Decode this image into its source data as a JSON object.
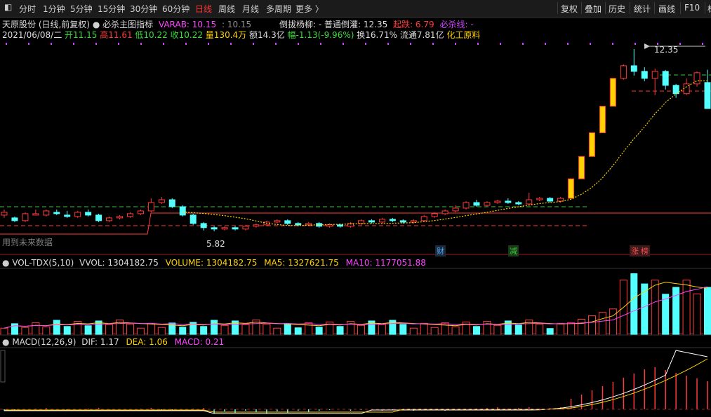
{
  "toolbar": {
    "left_tabs": [
      "分时",
      "1分钟",
      "5分钟",
      "15分钟",
      "30分钟",
      "60分钟",
      "日线",
      "周线",
      "月线",
      "多周期",
      "更多 〉"
    ],
    "active_tab": "日线",
    "right_tabs": [
      "复权",
      "叠加",
      "历史",
      "统计",
      "画线",
      "F10",
      "标"
    ]
  },
  "info1": {
    "stock": "天原股份 (日线,前复权)",
    "indicator": "必杀主图指标",
    "varab": "VARAB: 10.15",
    "varab2": ": 10.15",
    "daoba": "倒拔杨柳: - 普通倒灌: 12.35",
    "qidie": "起跌: 6.79",
    "bisha": "必杀线: -"
  },
  "info2": {
    "date": "2021/06/08/二",
    "open": "开11.15",
    "high": "高11.61",
    "low": "低10.22",
    "close": "收10.22",
    "vol": "量130.4万",
    "amount": "额14.3亿",
    "change": "幅-1.13(-9.96%)",
    "turnover": "换16.71%",
    "float": "流通7.81亿",
    "sector": "化工原料"
  },
  "price_panel": {
    "max_label": "12.35",
    "min_label": "5.82",
    "future_label": "用到未来数据",
    "markers": [
      {
        "text": "财",
        "color": "#4da6ff"
      },
      {
        "text": "减",
        "color": "#3cc83c"
      },
      {
        "text": "涨",
        "color": "#ff4d4d"
      },
      {
        "text": "榜",
        "color": "#ff4d4d"
      }
    ]
  },
  "vol_title": {
    "name": "VOL-TDX(5,10)",
    "vvol": "VVOL: 1304182.75",
    "volume": "VOLUME: 1304182.75",
    "ma5": "MA5: 1327621.75",
    "ma10": "MA10: 1177051.88"
  },
  "macd_title": {
    "name": "MACD(12,26,9)",
    "dif": "DIF: 1.17",
    "dea": "DEA: 1.06",
    "macd": "MACD: 0.21"
  },
  "colors": {
    "up": "#ff3c3c",
    "down": "#54ffff",
    "yellow_box": "#ffd200",
    "ma5": "#ffffff",
    "ma10": "#ffd200",
    "ma20": "#ff44ff"
  },
  "chart_data": {
    "type": "candlestick",
    "x": [
      "2021/06/08/二"
    ],
    "series": [
      {
        "name": "开",
        "values": [
          11.15
        ]
      },
      {
        "name": "高",
        "values": [
          11.61
        ]
      },
      {
        "name": "低",
        "values": [
          10.22
        ]
      },
      {
        "name": "收",
        "values": [
          10.22
        ]
      }
    ]
  }
}
